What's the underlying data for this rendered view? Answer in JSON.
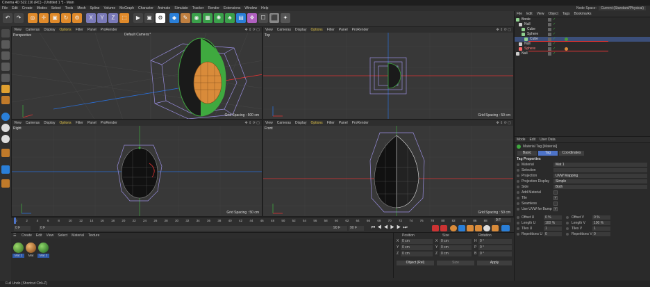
{
  "app": {
    "title": "Cinema 4D S22.116 (RC) - [Untitled 1 *] - Main",
    "node_space_label": "Node Space:",
    "node_space_value": "Current (Standard/Physical)"
  },
  "menu": [
    "File",
    "Edit",
    "Create",
    "Modes",
    "Select",
    "Tools",
    "Mesh",
    "Spline",
    "Volume",
    "MoGraph",
    "Character",
    "Animate",
    "Simulate",
    "Tracker",
    "Render",
    "Extensions",
    "Window",
    "Help"
  ],
  "viewport_menu": {
    "view": "View",
    "cameras": "Cameras",
    "display": "Display",
    "options": "Options",
    "filter": "Filter",
    "panel": "Panel",
    "prorender": "ProRender"
  },
  "viewports": {
    "perspective": {
      "name": "Perspective",
      "camera": "Default Camera:*",
      "grid": "Grid Spacing : 500 cm"
    },
    "top": {
      "name": "Top",
      "grid": "Grid Spacing : 50 cm"
    },
    "right": {
      "name": "Right",
      "grid": "Grid Spacing : 50 cm"
    },
    "front": {
      "name": "Front",
      "grid": "Grid Spacing : 50 cm"
    }
  },
  "object_manager": {
    "menu": [
      "File",
      "Edit",
      "View",
      "Object",
      "Tags",
      "Bookmarks"
    ],
    "objects": [
      {
        "label": "Boole",
        "color": "#8fd18f"
      },
      {
        "label": "Null",
        "color": "#cccccc"
      },
      {
        "label": "Cube",
        "color": "#8fd18f"
      },
      {
        "label": "Sphere",
        "color": "#8fd18f"
      },
      {
        "label": "Cube",
        "color": "#8fd18f"
      },
      {
        "label": "Null",
        "color": "#cccccc"
      },
      {
        "label": "Sphere",
        "color": "#ff6666"
      },
      {
        "label": "Null",
        "color": "#cccccc"
      }
    ]
  },
  "attributes": {
    "menu": [
      "Mode",
      "Edit",
      "User Data"
    ],
    "header": "Material Tag [Material]",
    "tabs": [
      "Basic",
      "Tag",
      "Coordinates"
    ],
    "section": "Tag Properties",
    "rows": [
      {
        "label": "Material",
        "value": "Mat 1"
      },
      {
        "label": "Selection",
        "value": ""
      },
      {
        "label": "Projection",
        "value": "UVW Mapping"
      },
      {
        "label": "Projection Display",
        "value": "Simple"
      },
      {
        "label": "Side",
        "value": "Both"
      }
    ],
    "checks": [
      {
        "label": "Add Material"
      },
      {
        "label": "Tile"
      },
      {
        "label": "Seamless"
      },
      {
        "label": "Use UVW for Bump"
      }
    ],
    "uv": [
      {
        "label": "Offset U",
        "value": "0 %",
        "label2": "Offset V",
        "value2": "0 %"
      },
      {
        "label": "Length U",
        "value": "100 %",
        "label2": "Length V",
        "value2": "100 %"
      },
      {
        "label": "Tiles U",
        "value": "1",
        "label2": "Tiles V",
        "value2": "1"
      },
      {
        "label": "Repetitions U",
        "value": "0",
        "label2": "Repetitions V",
        "value2": "0"
      }
    ]
  },
  "timeline": {
    "ticks": [
      "0",
      "2",
      "4",
      "6",
      "8",
      "10",
      "12",
      "14",
      "16",
      "18",
      "20",
      "22",
      "24",
      "26",
      "28",
      "30",
      "32",
      "34",
      "36",
      "38",
      "40",
      "42",
      "44",
      "46",
      "48",
      "50",
      "52",
      "54",
      "56",
      "58",
      "60",
      "62",
      "64",
      "66",
      "68",
      "70",
      "72",
      "74",
      "76",
      "78",
      "80",
      "82",
      "84",
      "86",
      "88",
      "90"
    ],
    "current_frame": "0 F",
    "start": "0 F",
    "min": "0 F",
    "end": "90 F",
    "max": "90 F"
  },
  "material_manager": {
    "menu": [
      "Create",
      "Edit",
      "View",
      "Select",
      "Material",
      "Texture"
    ],
    "materials": [
      {
        "label": "Mat 1",
        "color": "#4a9a3a"
      },
      {
        "label": "Mat",
        "color": "#b07030"
      },
      {
        "label": "Mat 2",
        "color": "#2f7a2f"
      }
    ]
  },
  "coordinates": {
    "headers": [
      "Position",
      "Size",
      "Rotation"
    ],
    "rows": [
      {
        "axis": "X",
        "pos": "0 cm",
        "size_axis": "X",
        "size": "0 cm",
        "rot_axis": "H",
        "rot": "0 °"
      },
      {
        "axis": "Y",
        "pos": "0 cm",
        "size_axis": "Y",
        "size": "0 cm",
        "rot_axis": "P",
        "rot": "0 °"
      },
      {
        "axis": "Z",
        "pos": "0 cm",
        "size_axis": "Z",
        "size": "0 cm",
        "rot_axis": "B",
        "rot": "0 °"
      }
    ],
    "mode": "Object (Rel)",
    "size_mode": "Size",
    "apply": "Apply"
  },
  "status": "Full Undo (Shortcut Ctrl+Z)"
}
